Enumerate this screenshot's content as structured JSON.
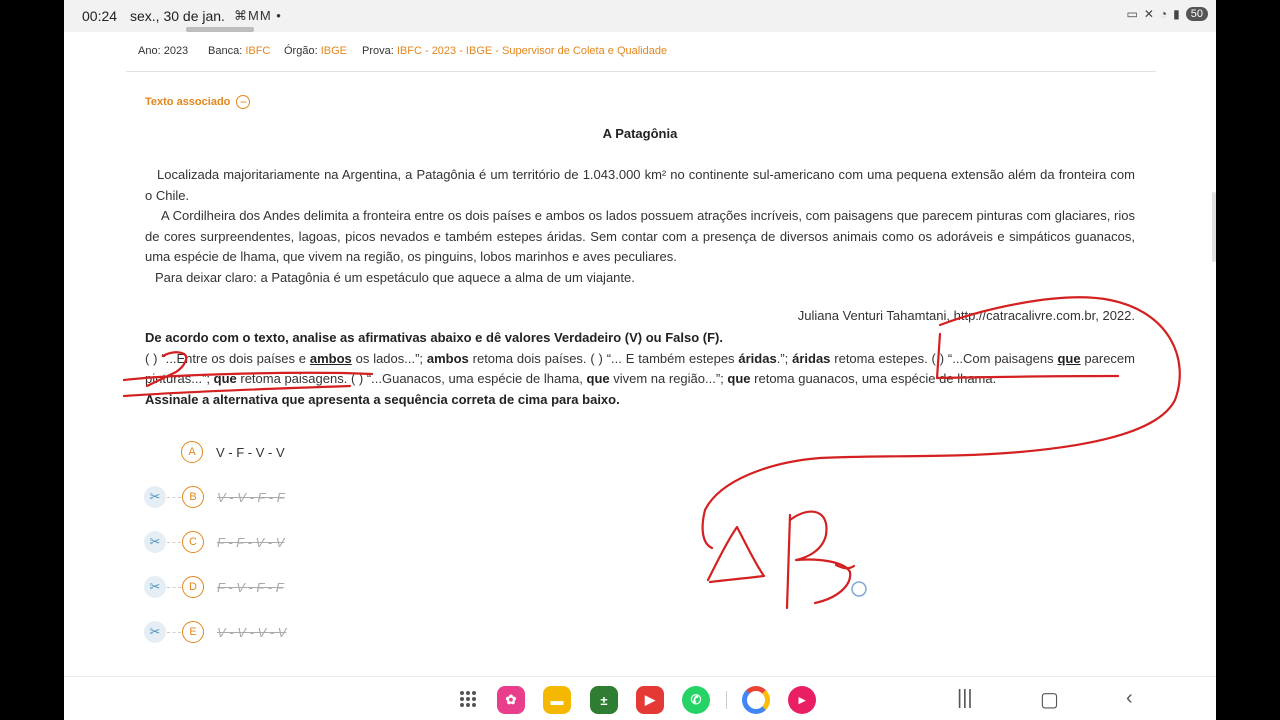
{
  "status": {
    "time": "00:24",
    "date": "sex., 30 de jan.",
    "notif_icons": "⌘MM •",
    "battery": "50"
  },
  "meta": {
    "ano_label": "Ano:",
    "ano": "2023",
    "banca_label": "Banca:",
    "banca": "IBFC",
    "orgao_label": "Órgão:",
    "orgao": "IBGE",
    "prova_label": "Prova:",
    "prova": "IBFC - 2023 - IBGE - Supervisor de Coleta e Qualidade"
  },
  "texto_associado": "Texto associado",
  "text": {
    "title": "A Patagônia",
    "p1": "Localizada majoritariamente na Argentina, a Patagônia é um território de 1.043.000 km² no continente sul-americano com uma pequena extensão além da fronteira com o Chile.",
    "p2": "A Cordilheira dos Andes delimita a fronteira entre os dois países e ambos os lados possuem atrações incríveis, com paisagens que parecem pinturas com glaciares, rios de cores surpreendentes, lagoas, picos nevados e também estepes áridas. Sem contar com a presença de diversos animais como os adoráveis e simpáticos guanacos, uma espécie de lhama, que vivem na região, os pinguins, lobos marinhos e aves peculiares.",
    "p3": "Para deixar claro: a Patagônia é um espetáculo que aquece a alma de um viajante.",
    "author": "Juliana Venturi Tahamtani, http://catracalivre.com.br, 2022."
  },
  "question": {
    "heading": "De acordo com o texto, analise as afirmativas abaixo e dê valores Verdadeiro (V) ou Falso (F).",
    "s1a": "( ) “...Entre os dois países e ",
    "s1u": "ambos",
    "s1b": " os lados...”; ",
    "s1c": "ambos",
    "s1d": " retoma dois países. ( ) “... E também estepes ",
    "s2u": "áridas",
    "s2a": ".”; ",
    "s2b": "áridas",
    "s2c": " retoma estepes. ( ) “...Com paisagens ",
    "s3u": "que",
    "s3a": " parecem pinturas...”; ",
    "s3b": "que",
    "s3c": " retoma paisagens. ( ) “...Guanacos, uma espécie de lhama, ",
    "s4u": "que",
    "s4a": " vivem na região...”; ",
    "s4b": "que",
    "s4c": " retoma guanacos, uma espécie de lhama.",
    "footer": "Assinale a alternativa que apresenta a sequência correta de cima para baixo."
  },
  "options": [
    {
      "letter": "A",
      "text": "V - F - V - V"
    },
    {
      "letter": "B",
      "text": "V - V - F - F"
    },
    {
      "letter": "C",
      "text": "F - F - V - V"
    },
    {
      "letter": "D",
      "text": "F - V - F - F"
    },
    {
      "letter": "E",
      "text": "V - V - V - V"
    }
  ],
  "handwritten_answer": "D B",
  "colors": {
    "accent": "#e3861c",
    "ink": "#d42020",
    "scissor": "#4a90c0"
  }
}
